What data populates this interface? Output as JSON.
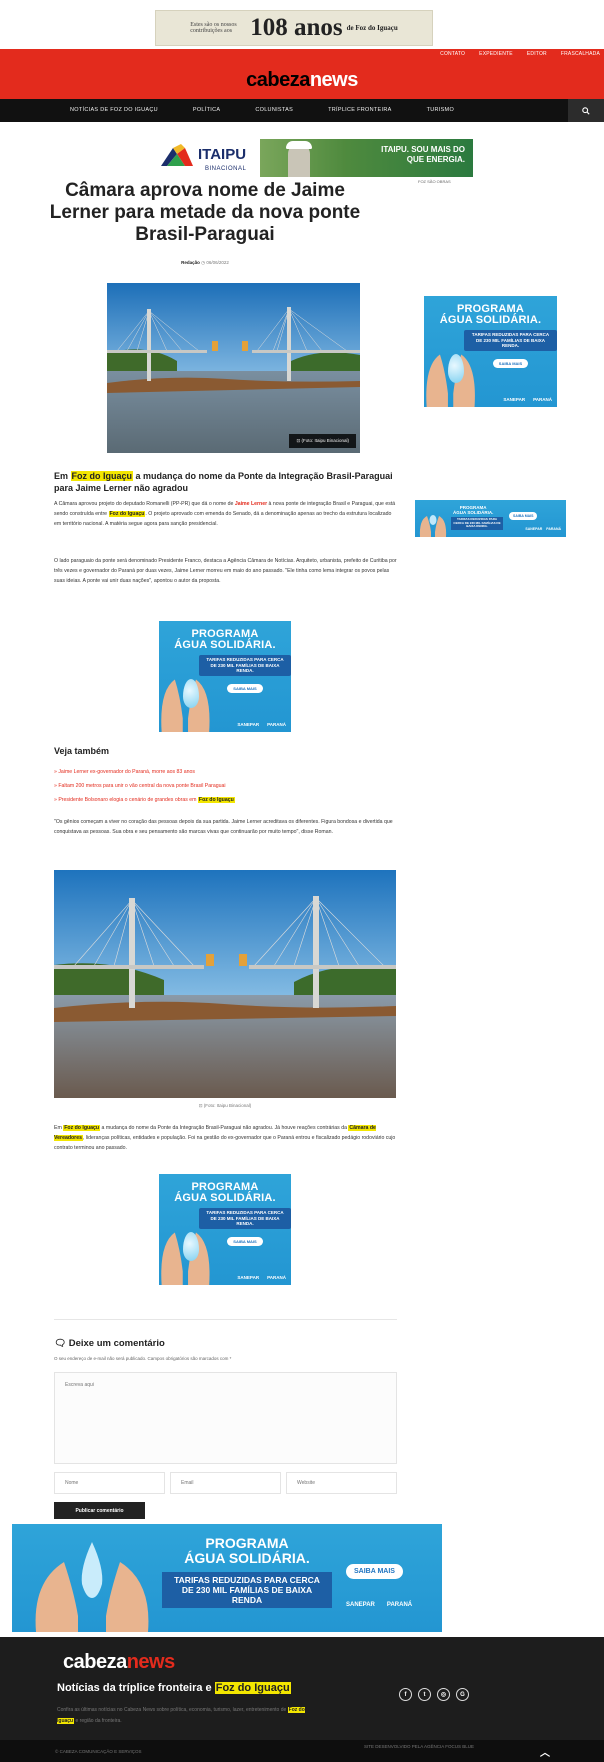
{
  "top_banner": {
    "small": "Estes são os nossos contribuições aos",
    "big": "108 anos",
    "tail": "de Foz do Iguaçu"
  },
  "header": {
    "top_links": [
      "CONTATO",
      "EXPEDIENTE",
      "EDITOR",
      "FRASCALHADA"
    ],
    "logo_part1": "cabeza",
    "logo_part2": "news"
  },
  "nav": {
    "items": [
      "NOTÍCIAS DE FOZ DO IGUAÇU",
      "POLÍTICA",
      "COLUNISTAS",
      "TRÍPLICE FRONTEIRA",
      "TURISMO"
    ],
    "search_icon": "search-icon"
  },
  "itaipu_ad": {
    "brand": "ITAIPU",
    "brand_sub": "BINACIONAL",
    "slogan_1": "ITAIPU. SOU MAIS DO",
    "slogan_2": "QUE ENERGIA.",
    "label": "FOZ SÃO OBRAS"
  },
  "article": {
    "title": "Câmara aprova nome de Jaime Lerner para metade da nova ponte Brasil-Paraguai",
    "author": "Redação",
    "date": "06/06/2022",
    "photo_credit_1": "(Foto: Itaipu Binacional)",
    "subtitle_pre": "Em ",
    "subtitle_hl": "Foz do Iguaçu",
    "subtitle_post": " a mudança do nome da Ponte da Integração Brasil-Paraguai para Jaime Lerner não agradou",
    "p1_a": "A Câmara aprovou projeto do deputado Romanelli (PP-PR) que dá o nome de ",
    "p1_name": "Jaime Lerner",
    "p1_b": " à nova ponte de integração Brasil e Paraguai, que está sendo construída entre ",
    "p1_hl": "Foz do Iguaçu",
    "p1_c": ". O projeto aprovado com emenda do Senado, dá a denominação apenas ao trecho da estrutura localizado em território nacional. A matéria segue agora para sanção presidencial.",
    "p2": "O lado paraguaio da ponte será denominado Presidente Franco, destaca a Agência Câmara de Notícias. Arquiteto, urbanista, prefeito de Curitiba por três vezes e governador do Paraná por duas vezes, Jaime Lerner morreu em maio do ano passado. \"Ele tinha como lema integrar os povos pelas suas ideias. A ponte vai unir duas nações\", apontou o autor da proposta.",
    "p3": "\"Os gênios começam a viver no coração das pessoas depois da sua partida. Jaime Lerner acreditava os diferentes. Figura bondosa e divertida que conquistava as pessoas. Sua obra e seu pensamento são marcas vivas que continuarão por muito tempo\", disse Roman.",
    "photo_credit_2": "(Foto: Itaipu Binacional)",
    "p4_a": "Em ",
    "p4_hl1": "Foz do Iguaçu",
    "p4_b": " a mudança do nome da Ponte da Integração Brasil-Paraguai não agradou. Já houve reações contrárias da ",
    "p4_hl2": "Câmara de Vereadores",
    "p4_c": ", lideranças políticas, entidades e população. Foi na gestão do ex-governador que o Paraná entrou e fiscalizado pedágio rodoviário cujo contrato terminou ano passado."
  },
  "veja": {
    "title": "Veja também",
    "item1": "Jaime Lerner ex-governador do Paraná, morre aos 83 anos",
    "item2": "Faltam 200 metros para unir o vão central da nova ponte Brasil Paraguai",
    "item3_a": "Presidente Bolsonaro elogia o cenário de grandes obras em ",
    "item3_hl": "Foz do Iguaçu"
  },
  "agua_ad": {
    "title_1": "PROGRAMA",
    "title_2": "ÁGUA SOLIDÁRIA.",
    "tag": "TARIFAS REDUZIDAS PARA CERCA DE 230 MIL FAMÍLIAS DE BAIXA RENDA.",
    "button": "SAIBA MAIS",
    "logo_1": "SANEPAR",
    "logo_2": "PARANÁ",
    "wide_tag": "TARIFAS REDUZIDAS PARA CERCA DE 230 MIL FAMÍLIAS DE BAIXA RENDA"
  },
  "comments": {
    "title": "Deixe um comentário",
    "note": "O seu endereço de e-mail não será publicado. Campos obrigatórios são marcados com *",
    "text_placeholder": "Escreva aqui",
    "name_placeholder": "Nome",
    "email_placeholder": "Email",
    "website_placeholder": "Website",
    "submit": "Publicar comentário"
  },
  "footer": {
    "logo_part1": "cabeza",
    "logo_part2": "news",
    "tagline_pre": "Notícias da tríplice fronteira e ",
    "tagline_hl": "Foz do Iguaçu",
    "desc_a": "Confira as últimas notícias no Cabeza News sobre política, economia, turismo, lazer, entretenimento de ",
    "desc_hl": "Foz do Iguaçu",
    "desc_b": " e região da fronteira.",
    "social": [
      "f",
      "t",
      "◎",
      "G"
    ],
    "copyright": "© CABEZA COMUNICAÇÃO E SERVIÇOS",
    "dev": "SITE DESENVOLVIDO PELA AGÊNCIA FOCUS BLUE"
  },
  "colors": {
    "brand_red": "#e32b1d",
    "highlight": "#f3e600",
    "ad_blue": "#2396d2"
  }
}
